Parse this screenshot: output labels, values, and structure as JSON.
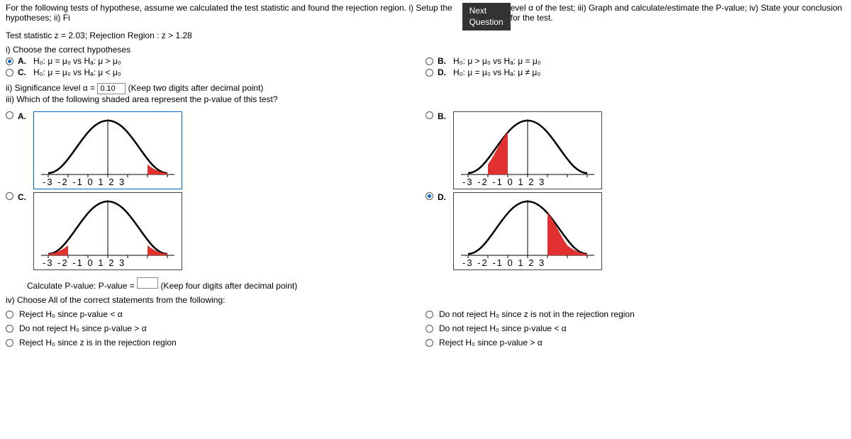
{
  "header": {
    "part1": "For the following tests of hypothese, assume we calculated the test statistic and found the rejection region. i) Setup the hypotheses; ii) Fi",
    "nextq_line1": "Next",
    "nextq_line2": "Question",
    "part2": "evel α of the test; iii) Graph and calculate/estimate the P-value; iv) State your conclusion for the test.",
    "line2": "Test statistic z = 2.03;  Rejection Region :  z > 1.28"
  },
  "i": {
    "prompt": "i)  Choose the correct hypotheses",
    "optA": "H₀: μ = μ₀ vs Hₐ: μ > μ₀",
    "optB": "H₀: μ > μ₀ vs Hₐ: μ = μ₀",
    "optC": "H₀: μ = μ₀ vs Hₐ: μ < μ₀",
    "optD": "H₀: μ = μ₀ vs Hₐ: μ ≠ μ₀"
  },
  "ii": {
    "label_pre": "ii)  Significance level α = ",
    "value": "0.10",
    "label_post": " (Keep two digits after decimal point)"
  },
  "iii": {
    "prompt": "iii)  Which of the following shaded area represent the p-value of this test?",
    "A": "A.",
    "B": "B.",
    "C": "C.",
    "D": "D.",
    "ticks": "-3  -2  -1   0   1   2   3"
  },
  "pval": {
    "pre": "Calculate P-value:  P-value = ",
    "post": " (Keep four digits after decimal point)"
  },
  "iv": {
    "prompt": "iv)  Choose All of the correct statements from the following:",
    "s1": "Reject H₀ since p-value < α",
    "s2": "Do not reject H₀ since z is not in the rejection region",
    "s3": "Do not reject H₀ since p-value > α",
    "s4": "Do not reject H₀ since p-value < α",
    "s5": "Reject H₀ since z is in the rejection region",
    "s6": "Reject H₀ since p-value > α"
  }
}
